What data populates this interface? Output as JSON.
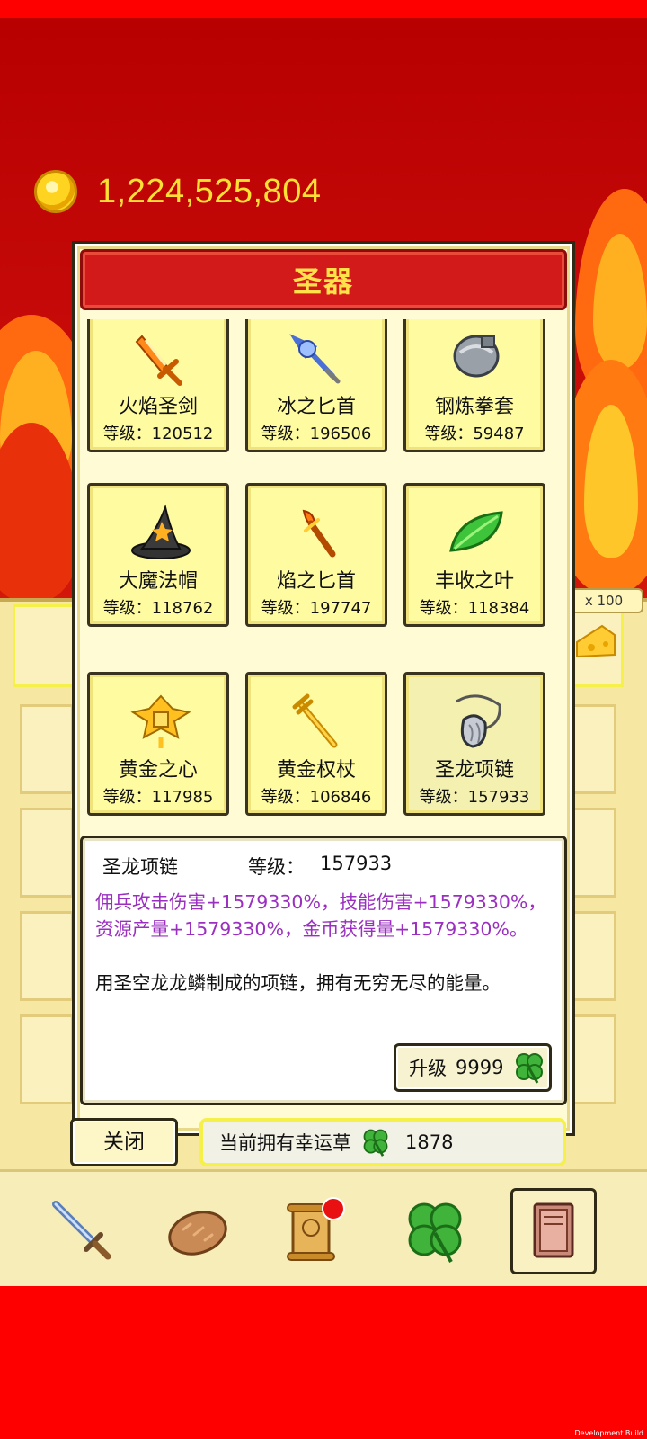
{
  "currency": {
    "gold_amount": "1,224,525,804",
    "icon": "gold-coin-icon"
  },
  "background": {
    "multiplier_badge": "x 100"
  },
  "popup": {
    "title": "圣器",
    "artifacts": [
      {
        "name": "火焰圣剑",
        "level_text": "等级：120512",
        "icon": "flame-sword-icon"
      },
      {
        "name": "冰之匕首",
        "level_text": "等级：196506",
        "icon": "ice-dagger-icon"
      },
      {
        "name": "钢炼拳套",
        "level_text": "等级：59487",
        "icon": "steel-gauntlet-icon"
      },
      {
        "name": "大魔法帽",
        "level_text": "等级：118762",
        "icon": "wizard-hat-icon"
      },
      {
        "name": "焰之匕首",
        "level_text": "等级：197747",
        "icon": "flame-dagger-icon"
      },
      {
        "name": "丰收之叶",
        "level_text": "等级：118384",
        "icon": "harvest-leaf-icon"
      },
      {
        "name": "黄金之心",
        "level_text": "等级：117985",
        "icon": "golden-heart-icon"
      },
      {
        "name": "黄金权杖",
        "level_text": "等级：106846",
        "icon": "golden-scepter-icon"
      },
      {
        "name": "圣龙项链",
        "level_text": "等级：157933",
        "icon": "dragon-necklace-icon",
        "selected": true
      }
    ],
    "detail": {
      "name": "圣龙项链",
      "level_label": "等级：",
      "level_value": "157933",
      "effect": "佣兵攻击伤害+1579330%，技能伤害+1579330%，资源产量+1579330%，金币获得量+1579330%。",
      "description": "用圣空龙龙鳞制成的项链，拥有无穷无尽的能量。",
      "upgrade_label": "升级",
      "upgrade_cost": "9999",
      "upgrade_icon": "clover-icon"
    },
    "close_label": "关闭",
    "luck": {
      "label": "当前拥有幸运草",
      "value": "1878",
      "icon": "clover-icon"
    }
  },
  "nav": [
    {
      "icon": "sword-icon"
    },
    {
      "icon": "bread-icon"
    },
    {
      "icon": "scroll-icon",
      "has_badge": true
    },
    {
      "icon": "clover-icon"
    },
    {
      "icon": "book-icon",
      "active": true
    }
  ],
  "footer": {
    "dev_build": "Development Build"
  },
  "colors": {
    "background_red": "#ff0000",
    "title_bar": "#d21a1a",
    "title_text": "#ffe24a",
    "effect_text": "#9b2fc0",
    "gold_text": "#ffe135"
  }
}
